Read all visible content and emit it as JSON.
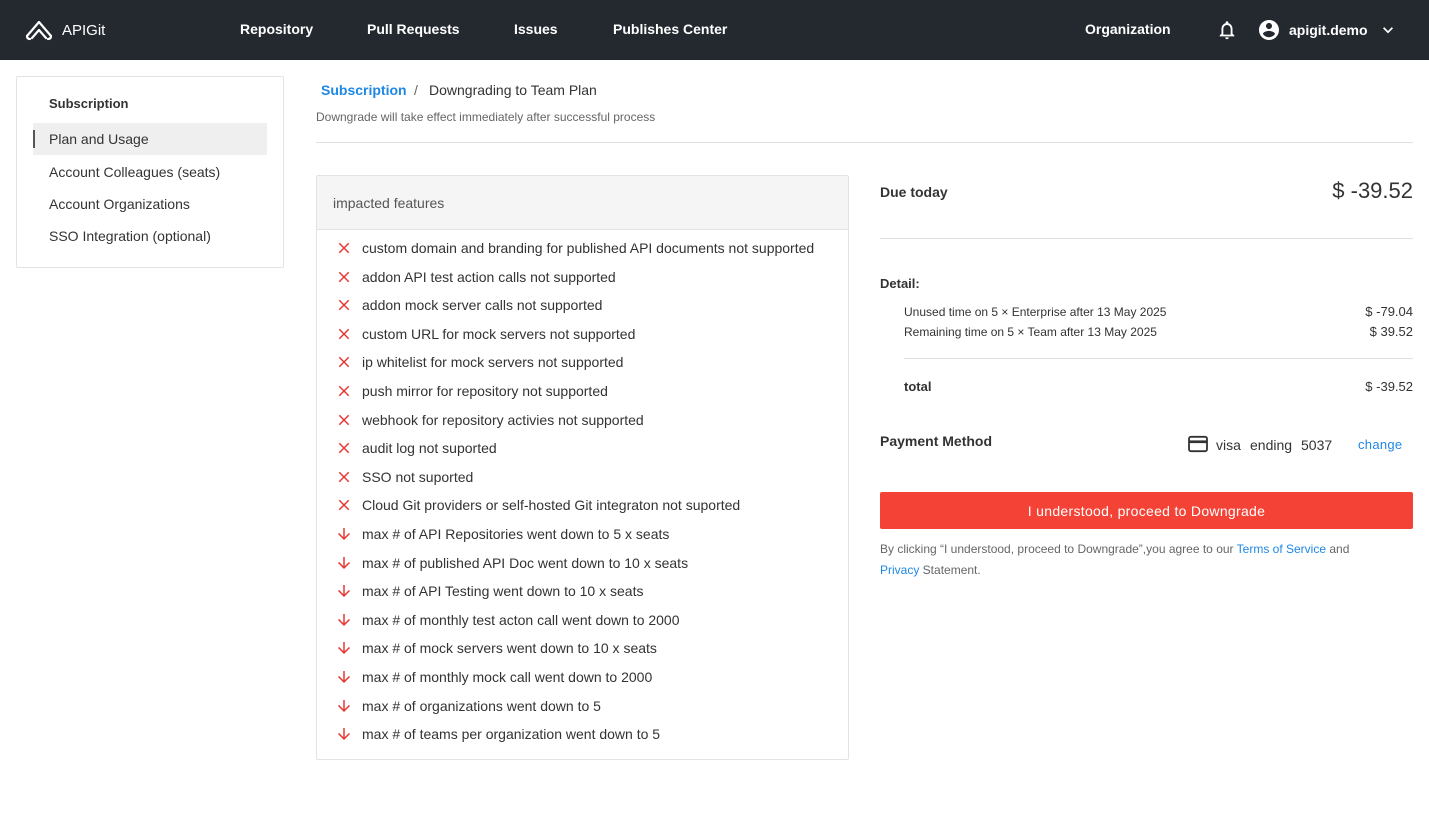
{
  "header": {
    "brand": "APIGit",
    "nav": [
      "Repository",
      "Pull Requests",
      "Issues",
      "Publishes Center"
    ],
    "organization": "Organization",
    "username": "apigit.demo"
  },
  "sidebar": {
    "title": "Subscription",
    "items": [
      {
        "label": "Plan and Usage",
        "active": true
      },
      {
        "label": "Account Colleagues (seats)",
        "active": false
      },
      {
        "label": "Account Organizations",
        "active": false
      },
      {
        "label": "SSO Integration (optional)",
        "active": false
      }
    ]
  },
  "breadcrumb": {
    "root": "Subscription",
    "separator": "/",
    "current": "Downgrading to Team Plan"
  },
  "subtitle": "Downgrade will take effect immediately after successful process",
  "features": {
    "header": "impacted features",
    "items": [
      {
        "icon": "close-icon",
        "text": "custom domain and branding for published API documents not supported"
      },
      {
        "icon": "close-icon",
        "text": "addon API test action calls not supported"
      },
      {
        "icon": "close-icon",
        "text": "addon mock server calls not supported"
      },
      {
        "icon": "close-icon",
        "text": "custom URL for mock servers not supported"
      },
      {
        "icon": "close-icon",
        "text": "ip whitelist for mock servers not supported"
      },
      {
        "icon": "close-icon",
        "text": "push mirror for repository not supported"
      },
      {
        "icon": "close-icon",
        "text": "webhook for repository activies not supported"
      },
      {
        "icon": "close-icon",
        "text": "audit log not suported"
      },
      {
        "icon": "close-icon",
        "text": "SSO not suported"
      },
      {
        "icon": "close-icon",
        "text": "Cloud Git providers or self-hosted Git integraton not suported"
      },
      {
        "icon": "arrow-down-icon",
        "text": "max # of API Repositories went down to 5 x seats"
      },
      {
        "icon": "arrow-down-icon",
        "text": "max # of published API Doc went down to 10 x seats"
      },
      {
        "icon": "arrow-down-icon",
        "text": "max # of API Testing went down to 10 x seats"
      },
      {
        "icon": "arrow-down-icon",
        "text": "max # of monthly test acton call went down to 2000"
      },
      {
        "icon": "arrow-down-icon",
        "text": "max # of mock servers went down to 10 x seats"
      },
      {
        "icon": "arrow-down-icon",
        "text": "max # of monthly mock call went down to 2000"
      },
      {
        "icon": "arrow-down-icon",
        "text": "max # of organizations went down to 5"
      },
      {
        "icon": "arrow-down-icon",
        "text": "max # of teams per organization went down to 5"
      }
    ]
  },
  "summary": {
    "due_label": "Due today",
    "due_amount": "$ -39.52",
    "detail_label": "Detail:",
    "lines": [
      {
        "label": "Unused time on 5 × Enterprise after 13 May 2025",
        "value": "$ -79.04"
      },
      {
        "label": "Remaining time on 5 × Team after 13 May 2025",
        "value": "$ 39.52"
      }
    ],
    "total_label": "total",
    "total_value": "$ -39.52"
  },
  "payment": {
    "label": "Payment Method",
    "brand": "visa",
    "ending_label": "ending",
    "last4": "5037",
    "change": "change"
  },
  "proceed_button": "I understood, proceed to Downgrade",
  "terms": {
    "prefix": "By clicking “I understood, proceed to Downgrade”,you agree to our ",
    "tos_link": "Terms of Service",
    "and": " and",
    "privacy_link": "Privacy",
    "suffix": " Statement."
  },
  "colors": {
    "topbar": "#24292f",
    "accent": "#1e88e5",
    "danger": "#f44336",
    "icon_red": "#e53935"
  }
}
